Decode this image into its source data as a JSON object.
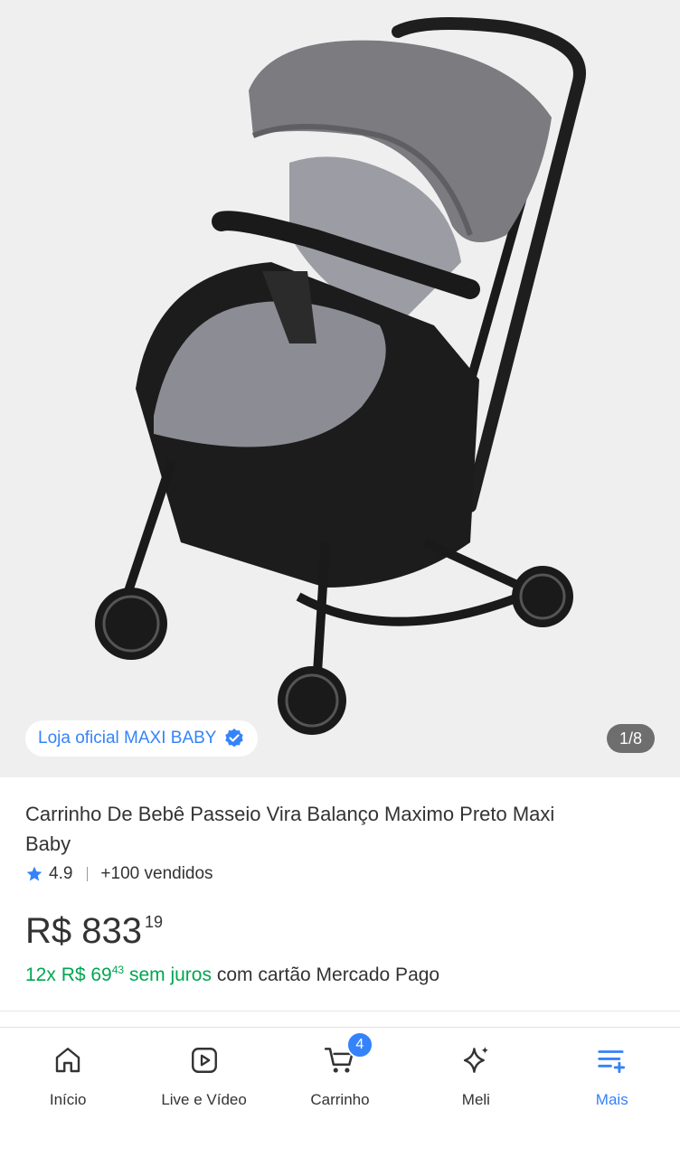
{
  "gallery": {
    "store_badge": "Loja oficial MAXI BABY",
    "counter": "1/8"
  },
  "product": {
    "title": "Carrinho De Bebê Passeio Vira Balanço Maximo Preto Maxi Baby",
    "rating": "4.9",
    "sold": "+100 vendidos",
    "price_main": "R$ 833",
    "price_cents": "19",
    "installments_prefix": "12x R$ 69",
    "installments_cents": "43",
    "installments_interest": "sem juros",
    "installments_suffix": "com cartão Mercado Pago"
  },
  "tabbar": {
    "items": [
      {
        "label": "Início",
        "icon": "home-icon"
      },
      {
        "label": "Live e Vídeo",
        "icon": "play-icon"
      },
      {
        "label": "Carrinho",
        "icon": "cart-icon",
        "badge": "4"
      },
      {
        "label": "Meli",
        "icon": "sparkle-icon"
      },
      {
        "label": "Mais",
        "icon": "menu-plus-icon",
        "active": true
      }
    ]
  },
  "colors": {
    "accent": "#3483fa",
    "green": "#00a650",
    "text": "#333333",
    "gallery_bg": "#efefef"
  }
}
